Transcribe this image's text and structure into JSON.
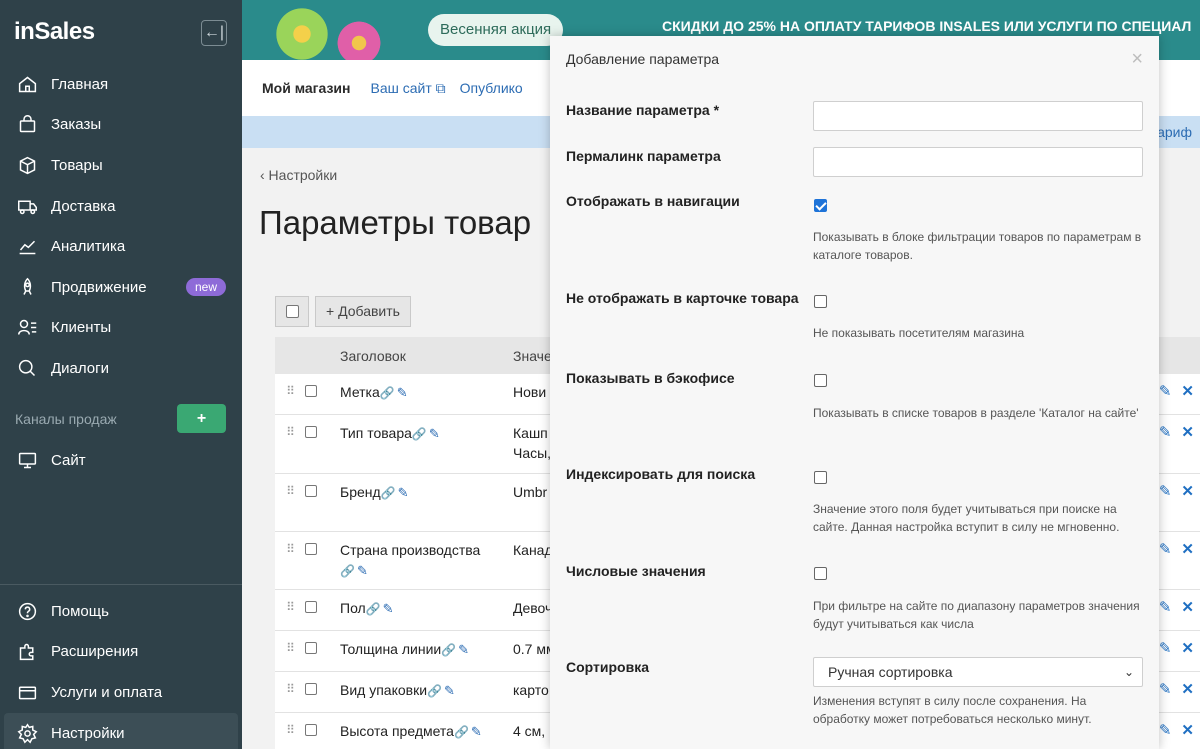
{
  "sidebar": {
    "logo": "inSales",
    "collapse_icon": "←|",
    "items": [
      {
        "label": "Главная",
        "icon": "home-icon"
      },
      {
        "label": "Заказы",
        "icon": "bag-icon"
      },
      {
        "label": "Товары",
        "icon": "box-icon"
      },
      {
        "label": "Доставка",
        "icon": "truck-icon"
      },
      {
        "label": "Аналитика",
        "icon": "chart-icon"
      },
      {
        "label": "Продвижение",
        "icon": "rocket-icon",
        "badge": "new"
      },
      {
        "label": "Клиенты",
        "icon": "users-icon"
      },
      {
        "label": "Диалоги",
        "icon": "chat-icon"
      }
    ],
    "channels_label": "Каналы продаж",
    "channels_add": "+",
    "site_label": "Сайт",
    "bottom_items": [
      {
        "label": "Помощь",
        "icon": "help-icon"
      },
      {
        "label": "Расширения",
        "icon": "puzzle-icon"
      },
      {
        "label": "Услуги и оплата",
        "icon": "card-icon"
      },
      {
        "label": "Настройки",
        "icon": "gear-icon"
      }
    ]
  },
  "promo": {
    "button": "Весенняя акция",
    "text": "СКИДКИ ДО 25% НА ОПЛАТУ ТАРИФОВ INSALES ИЛИ УСЛУГИ ПО СПЕЦИАЛ"
  },
  "topbar": {
    "shop": "Мой магазин",
    "site_link": "Ваш сайт",
    "publish": "Опублико"
  },
  "banner": {
    "right_text": "ариф"
  },
  "breadcrumb": "‹ Настройки",
  "page_title": "Параметры товар",
  "toolbar": {
    "add_label": "+ Добавить"
  },
  "table": {
    "headers": {
      "title": "Заголовок",
      "value": "Значе"
    },
    "rows": [
      {
        "title": "Метка",
        "value": "Нови",
        "value2": ""
      },
      {
        "title": "Тип товара",
        "value": "Кашп",
        "value2": "Часы,"
      },
      {
        "title": "Бренд",
        "value": "Umbr",
        "value2": ""
      },
      {
        "title": "Страна производства",
        "value": "Канад",
        "value2": ""
      },
      {
        "title": "Пол",
        "value": "Девоч",
        "value2": ""
      },
      {
        "title": "Толщина линии",
        "value": "0.7 мм",
        "value2": ""
      },
      {
        "title": "Вид упаковки",
        "value": "карто",
        "value2": ""
      },
      {
        "title": "Высота предмета",
        "value": "4 см,",
        "value2": ""
      }
    ]
  },
  "modal": {
    "title": "Добавление параметра",
    "close": "×",
    "name_label": "Название параметра *",
    "name_value": "",
    "permalink_label": "Пермалинк параметра",
    "permalink_value": "",
    "nav_label": "Отображать в навигации",
    "nav_checked": true,
    "nav_hint": "Показывать в блоке фильтрации товаров по параметрам в каталоге товаров.",
    "hide_card_label": "Не отображать в карточке товара",
    "hide_card_checked": false,
    "hide_card_hint": "Не показывать посетителям магазина",
    "backoffice_label": "Показывать в бэкофисе",
    "backoffice_checked": false,
    "backoffice_hint": "Показывать в списке товаров в разделе 'Каталог на сайте'",
    "index_label": "Индексировать для поиска",
    "index_checked": false,
    "index_hint": "Значение этого поля будет учитываться при поиске на сайте. Данная настройка вступит в силу не мгновенно.",
    "numeric_label": "Числовые значения",
    "numeric_checked": false,
    "numeric_hint": "При фильтре на сайте по диапазону параметров значения будут учитываться как числа",
    "sort_label": "Сортировка",
    "sort_value": "Ручная сортировка",
    "sort_hint": "Изменения вступят в силу после сохранения. На обработку может потребоваться несколько минут."
  }
}
